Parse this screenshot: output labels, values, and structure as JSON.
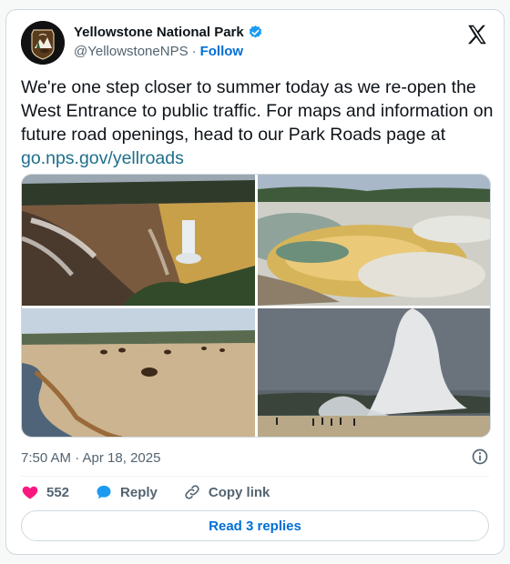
{
  "header": {
    "display_name": "Yellowstone National Park",
    "handle": "@YellowstoneNPS",
    "separator": "·",
    "follow_label": "Follow"
  },
  "post": {
    "text": "We're one step closer to summer today as we re-open the West Entrance to public traffic. For maps and information on future road openings, head to our Park Roads page at ",
    "link": "go.nps.gov/yellroads",
    "timestamp": "7:50 AM · Apr 18, 2025"
  },
  "actions": {
    "likes_count": "552",
    "reply_label": "Reply",
    "copy_link_label": "Copy link"
  },
  "footer": {
    "read_replies_label": "Read 3 replies"
  },
  "colors": {
    "accent": "#1d9bf0",
    "link": "#1d6f8c",
    "like": "#f91880",
    "muted": "#536471"
  },
  "icons": [
    "nps-logo",
    "verified-badge-icon",
    "x-logo-icon",
    "info-icon",
    "heart-icon",
    "reply-bubble-icon",
    "link-icon"
  ]
}
